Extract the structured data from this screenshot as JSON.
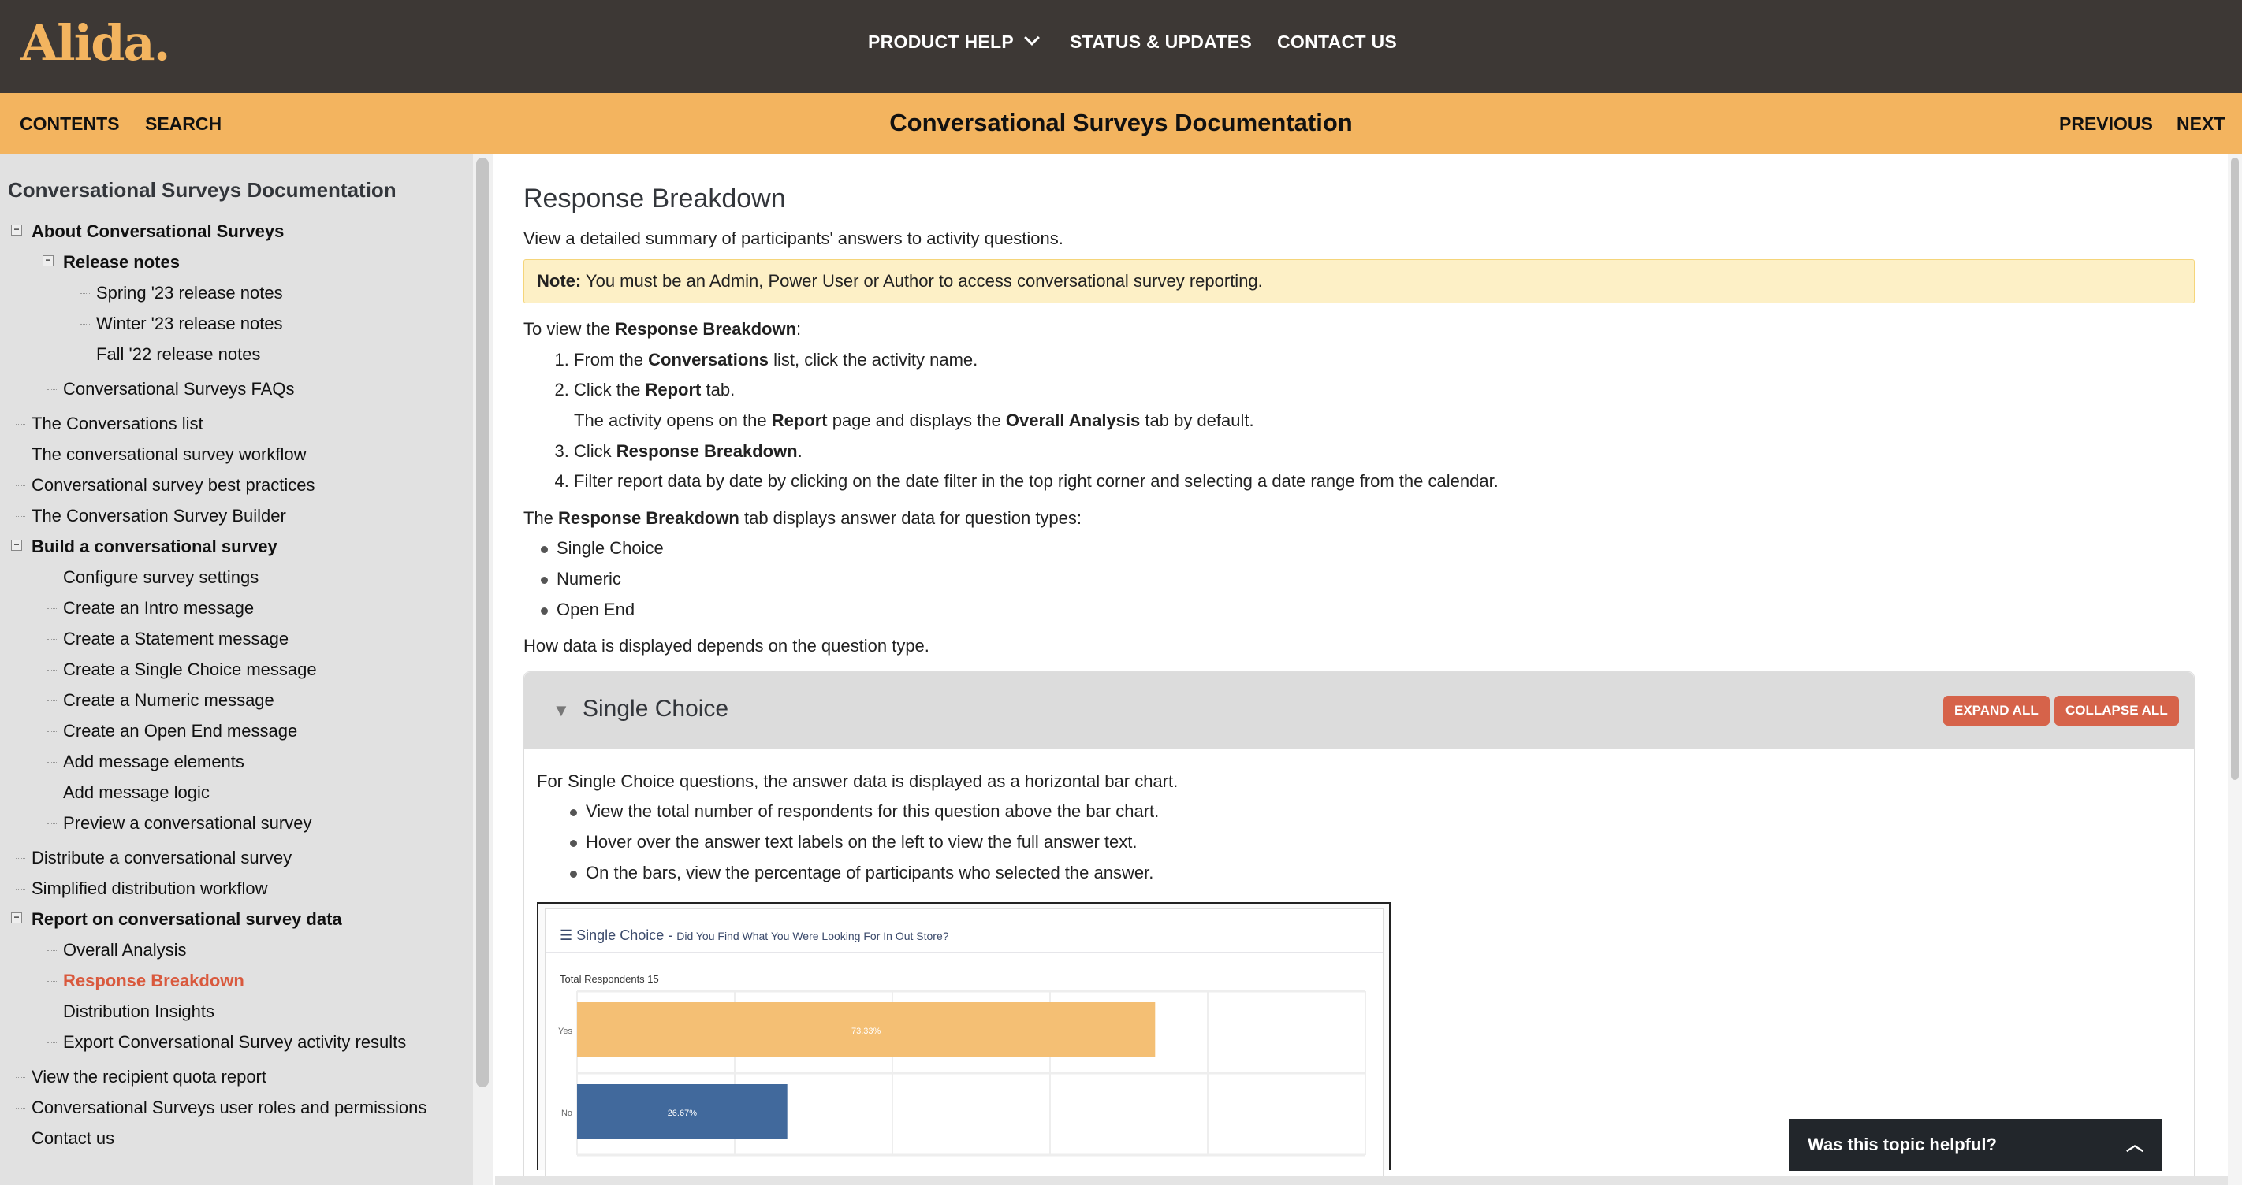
{
  "header": {
    "logo": "Alida.",
    "nav": [
      {
        "label": "PRODUCT HELP",
        "has_dropdown": true
      },
      {
        "label": "STATUS & UPDATES"
      },
      {
        "label": "CONTACT US"
      }
    ]
  },
  "toolbar": {
    "contents": "CONTENTS",
    "search": "SEARCH",
    "title": "Conversational Surveys Documentation",
    "previous": "PREVIOUS",
    "next": "NEXT"
  },
  "sidebar": {
    "title": "Conversational Surveys Documentation",
    "items": [
      {
        "label": "About Conversational Surveys",
        "level": 0,
        "bold": true,
        "expanded": true
      },
      {
        "label": "Release notes",
        "level": 1,
        "bold": true,
        "expanded": true
      },
      {
        "label": "Spring '23 release notes",
        "level": 2
      },
      {
        "label": "Winter '23 release notes",
        "level": 2
      },
      {
        "label": "Fall '22 release notes",
        "level": 2
      },
      {
        "label": "Conversational Surveys FAQs",
        "level": 1,
        "gap": true
      },
      {
        "label": "The Conversations list",
        "level": 0,
        "gap": true
      },
      {
        "label": "The conversational survey workflow",
        "level": 0
      },
      {
        "label": "Conversational survey best practices",
        "level": 0
      },
      {
        "label": "The Conversation Survey Builder",
        "level": 0
      },
      {
        "label": "Build a conversational survey",
        "level": 0,
        "bold": true,
        "expanded": true
      },
      {
        "label": "Configure survey settings",
        "level": 1
      },
      {
        "label": "Create an Intro message",
        "level": 1
      },
      {
        "label": "Create a Statement message",
        "level": 1
      },
      {
        "label": "Create a Single Choice message",
        "level": 1
      },
      {
        "label": "Create a Numeric message",
        "level": 1
      },
      {
        "label": "Create an Open End message",
        "level": 1
      },
      {
        "label": "Add message elements",
        "level": 1
      },
      {
        "label": "Add message logic",
        "level": 1
      },
      {
        "label": "Preview a conversational survey",
        "level": 1
      },
      {
        "label": "Distribute a conversational survey",
        "level": 0,
        "gap": true
      },
      {
        "label": "Simplified distribution workflow",
        "level": 0
      },
      {
        "label": "Report on conversational survey data",
        "level": 0,
        "bold": true,
        "expanded": true
      },
      {
        "label": "Overall Analysis",
        "level": 1
      },
      {
        "label": "Response Breakdown",
        "level": 1,
        "active": true
      },
      {
        "label": "Distribution Insights",
        "level": 1
      },
      {
        "label": "Export Conversational Survey activity results",
        "level": 1
      },
      {
        "label": "View the recipient quota report",
        "level": 0,
        "gap": true
      },
      {
        "label": "Conversational Surveys user roles and permissions",
        "level": 0
      },
      {
        "label": "Contact us",
        "level": 0
      }
    ]
  },
  "main": {
    "title": "Response Breakdown",
    "intro": "View a detailed summary of participants' answers to activity questions.",
    "note_label": "Note:",
    "note_text": " You must be an Admin, Power User or Author to access conversational survey reporting.",
    "to_view_a": "To view the ",
    "to_view_b": "Response Breakdown",
    "to_view_c": ":",
    "steps": {
      "s1a": "From the ",
      "s1b": "Conversations",
      "s1c": " list, click the activity name.",
      "s2a": "Click the ",
      "s2b": "Report",
      "s2c": " tab.",
      "s2sub_a": "The activity opens on the ",
      "s2sub_b": "Report",
      "s2sub_c": " page and displays the ",
      "s2sub_d": "Overall Analysis",
      "s2sub_e": " tab by default.",
      "s3a": "Click ",
      "s3b": "Response Breakdown",
      "s3c": ".",
      "s4": "Filter report data by date by clicking on the date filter in the top right corner and selecting a date range from the calendar."
    },
    "types_a": "The ",
    "types_b": "Response Breakdown",
    "types_c": " tab displays answer data for question types:",
    "types": [
      "Single Choice",
      "Numeric",
      "Open End"
    ],
    "depends": "How data is displayed depends on the question type.",
    "panel": {
      "title": "Single Choice",
      "expand_all": "EXPAND ALL",
      "collapse_all": "COLLAPSE ALL",
      "text": "For Single Choice questions, the answer data is displayed as a horizontal bar chart.",
      "bullets": [
        "View the total number of respondents for this question above the bar chart.",
        "Hover over the answer text labels on the left to view the full answer text.",
        "On the bars, view the percentage of participants who selected the answer."
      ]
    }
  },
  "chart_data": {
    "type": "bar",
    "orientation": "horizontal",
    "title": "Single Choice -",
    "subtitle": "Did You Find What You Were Looking For In Out Store?",
    "total_label": "Total Respondents 15",
    "categories": [
      "Yes",
      "No"
    ],
    "values": [
      73.33,
      26.67
    ],
    "value_labels": [
      "73.33%",
      "26.67%"
    ],
    "colors": [
      "#f4bf74",
      "#41699c"
    ],
    "xlim": [
      0,
      100
    ],
    "grid": true
  },
  "feedback": {
    "label": "Was this topic helpful?"
  },
  "colors": {
    "header": "#3d3835",
    "accent": "#f3b45f",
    "active": "#d9593d",
    "button": "#d6634a"
  }
}
